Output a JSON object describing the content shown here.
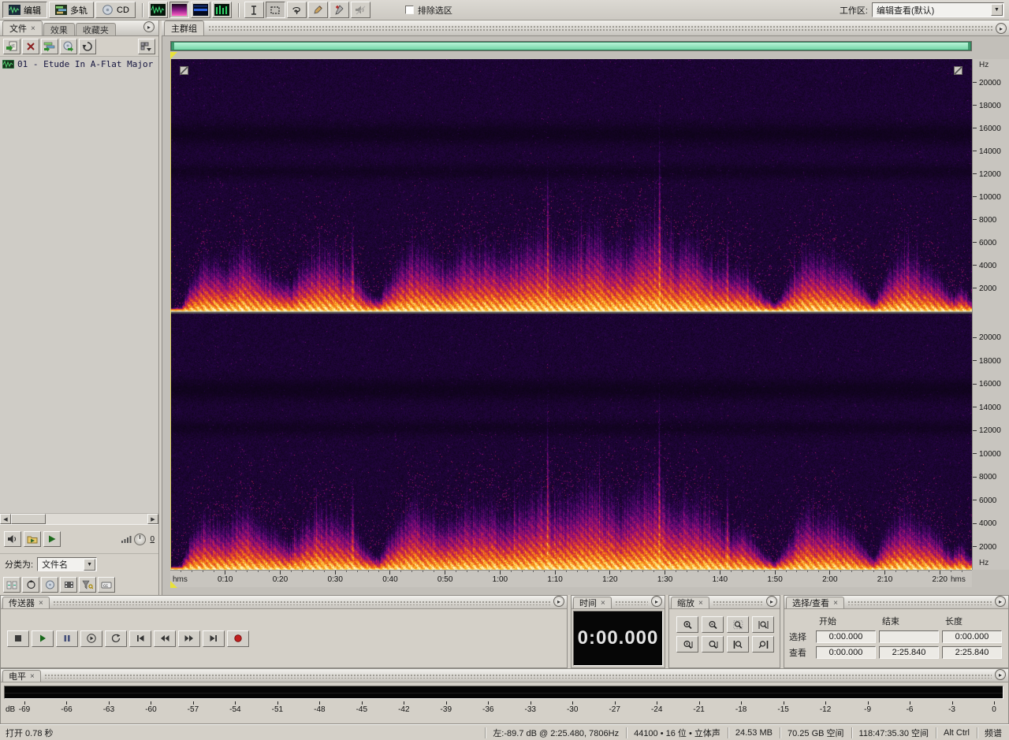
{
  "icons": {
    "flyout": "▸",
    "close": "×",
    "dropdown": "▼",
    "scroll_left": "◀",
    "scroll_right": "▶"
  },
  "toolbar": {
    "mode_buttons": [
      {
        "label": "编辑"
      },
      {
        "label": "多轨"
      },
      {
        "label": "CD"
      }
    ],
    "exclude_checkbox_label": "排除选区",
    "workspace_label": "工作区:",
    "workspace_value": "编辑查看(默认)"
  },
  "left_panel": {
    "tabs": [
      "文件",
      "效果",
      "收藏夹"
    ],
    "files": [
      {
        "name": "01 - Etude In A-Flat Major"
      }
    ],
    "sort_label": "分类为:",
    "sort_value": "文件名",
    "volume_value": "0"
  },
  "main": {
    "tab": "主群组",
    "freq_unit": "Hz",
    "freq_labels": [
      "20000",
      "18000",
      "16000",
      "14000",
      "12000",
      "10000",
      "8000",
      "6000",
      "4000",
      "2000"
    ],
    "time_unit": "hms",
    "time_labels": [
      "0:10",
      "0:20",
      "0:30",
      "0:40",
      "0:50",
      "1:00",
      "1:10",
      "1:20",
      "1:30",
      "1:40",
      "1:50",
      "2:00",
      "2:10",
      "2:20"
    ]
  },
  "panels": {
    "transport": {
      "title": "传送器"
    },
    "time": {
      "title": "时间",
      "value": "0:00.000"
    },
    "zoom": {
      "title": "缩放"
    },
    "selection": {
      "title": "选择/查看",
      "columns": [
        "开始",
        "结束",
        "长度"
      ],
      "rows": [
        {
          "label": "选择",
          "start": "0:00.000",
          "end": "",
          "length": "0:00.000"
        },
        {
          "label": "查看",
          "start": "0:00.000",
          "end": "2:25.840",
          "length": "2:25.840"
        }
      ]
    },
    "levels": {
      "title": "电平",
      "unit": "dB",
      "scale": [
        "-69",
        "-66",
        "-63",
        "-60",
        "-57",
        "-54",
        "-51",
        "-48",
        "-45",
        "-42",
        "-39",
        "-36",
        "-33",
        "-30",
        "-27",
        "-24",
        "-21",
        "-18",
        "-15",
        "-12",
        "-9",
        "-6",
        "-3",
        "0"
      ]
    }
  },
  "status_bar": {
    "left": "打开 0.78 秒",
    "cells": [
      "左:-89.7 dB @ 2:25.480, 7806Hz",
      "44100 • 16 位 • 立体声",
      "24.53 MB",
      "70.25 GB 空间",
      "118:47:35.30 空间",
      "Alt Ctrl",
      "频谱"
    ]
  }
}
